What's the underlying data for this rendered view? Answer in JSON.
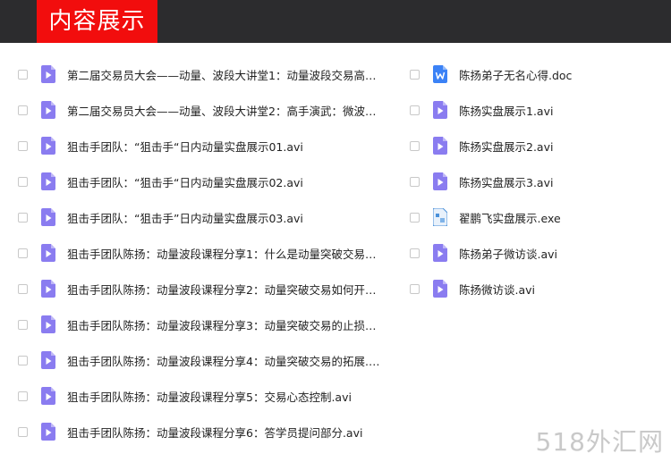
{
  "header": {
    "title": "内容展示"
  },
  "left_files": [
    {
      "name": "第二届交易员大会——动量、波段大讲堂1：动量波段交易高手 ...",
      "type": "video"
    },
    {
      "name": "第二届交易员大会——动量、波段大讲堂2：高手演武：微波段交...",
      "type": "video"
    },
    {
      "name": "狙击手团队：“狙击手“日内动量实盘展示01.avi",
      "type": "video"
    },
    {
      "name": "狙击手团队：“狙击手“日内动量实盘展示02.avi",
      "type": "video"
    },
    {
      "name": "狙击手团队：“狙击手”日内动量实盘展示03.avi",
      "type": "video"
    },
    {
      "name": "狙击手团队陈扬：动量波段课程分享1：什么是动量突破交易？动...",
      "type": "video"
    },
    {
      "name": "狙击手团队陈扬：动量波段课程分享2：动量突破交易如何开平仓...",
      "type": "video"
    },
    {
      "name": "狙击手团队陈扬：动量波段课程分享3：动量突破交易的止损与止...",
      "type": "video"
    },
    {
      "name": "狙击手团队陈扬：动量波段课程分享4：动量突破交易的拓展.avi",
      "type": "video"
    },
    {
      "name": "狙击手团队陈扬：动量波段课程分享5：交易心态控制.avi",
      "type": "video"
    },
    {
      "name": "狙击手团队陈扬：动量波段课程分享6：答学员提问部分.avi",
      "type": "video"
    }
  ],
  "right_files": [
    {
      "name": "陈扬弟子无名心得.doc",
      "type": "doc"
    },
    {
      "name": "陈扬实盘展示1.avi",
      "type": "video"
    },
    {
      "name": "陈扬实盘展示2.avi",
      "type": "video"
    },
    {
      "name": "陈扬实盘展示3.avi",
      "type": "video"
    },
    {
      "name": "翟鹏飞实盘展示.exe",
      "type": "exe"
    },
    {
      "name": "陈扬弟子微访谈.avi",
      "type": "video"
    },
    {
      "name": "陈扬微访谈.avi",
      "type": "video"
    }
  ],
  "icons": {
    "video": "video-file-icon",
    "doc": "word-file-icon",
    "exe": "exe-file-icon"
  },
  "colors": {
    "header_bg": "#2c2c2e",
    "title_bg": "#f20d0d",
    "video_icon": "#8a7cf0",
    "doc_icon": "#3b82f6"
  },
  "watermark": "518外汇网"
}
